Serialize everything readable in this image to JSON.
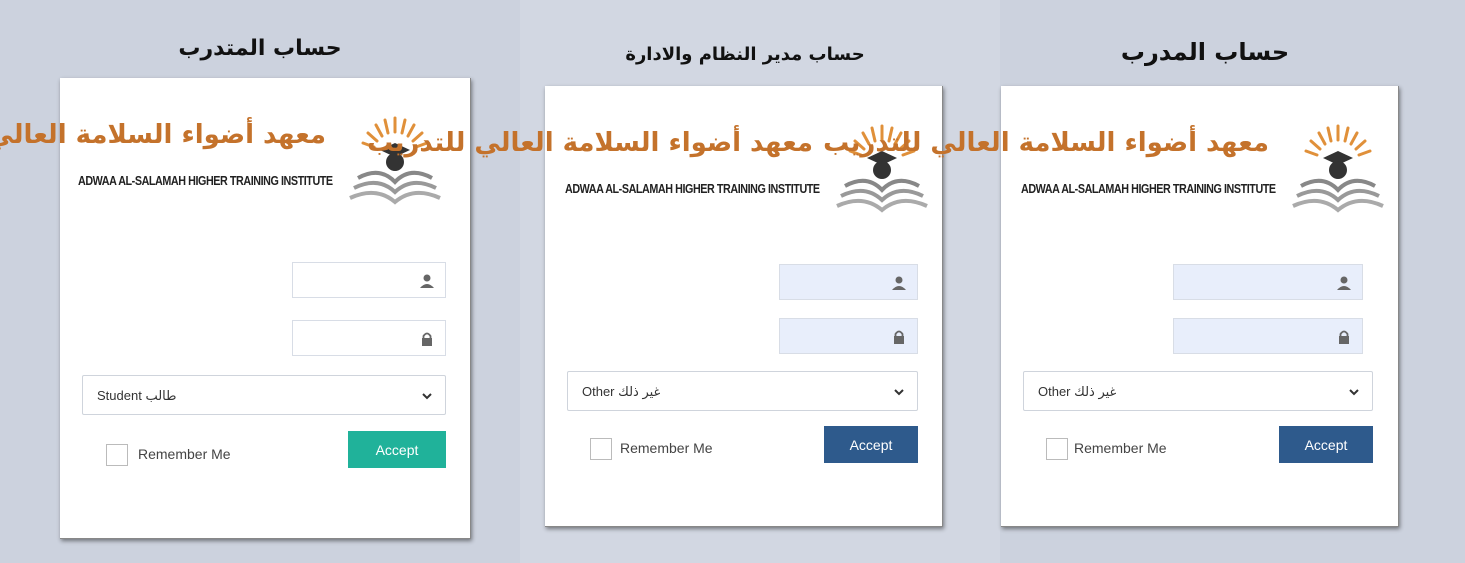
{
  "colors": {
    "logo_orange": "#c4722b",
    "accept_teal": "#20b29a",
    "accept_navy": "#2e5a8c",
    "input_highlight": "#e8eefb"
  },
  "logo": {
    "arabic": "معهد أضواء السلامة العالي للتدريب",
    "english": "ADWAA AL-SALAMAH HIGHER TRAINING INSTITUTE"
  },
  "panels": [
    {
      "title": "حساب المتدرب",
      "select_value": "طالب Student",
      "remember_label": "Remember Me",
      "accept_label": "Accept",
      "accept_color": "#20b29a"
    },
    {
      "title": "حساب مدير النظام والادارة",
      "select_value": "غير ذلك Other",
      "remember_label": "Remember Me",
      "accept_label": "Accept",
      "accept_color": "#2e5a8c"
    },
    {
      "title": "حساب المدرب",
      "select_value": "غير ذلك Other",
      "remember_label": "Remember Me",
      "accept_label": "Accept",
      "accept_color": "#2e5a8c"
    }
  ]
}
